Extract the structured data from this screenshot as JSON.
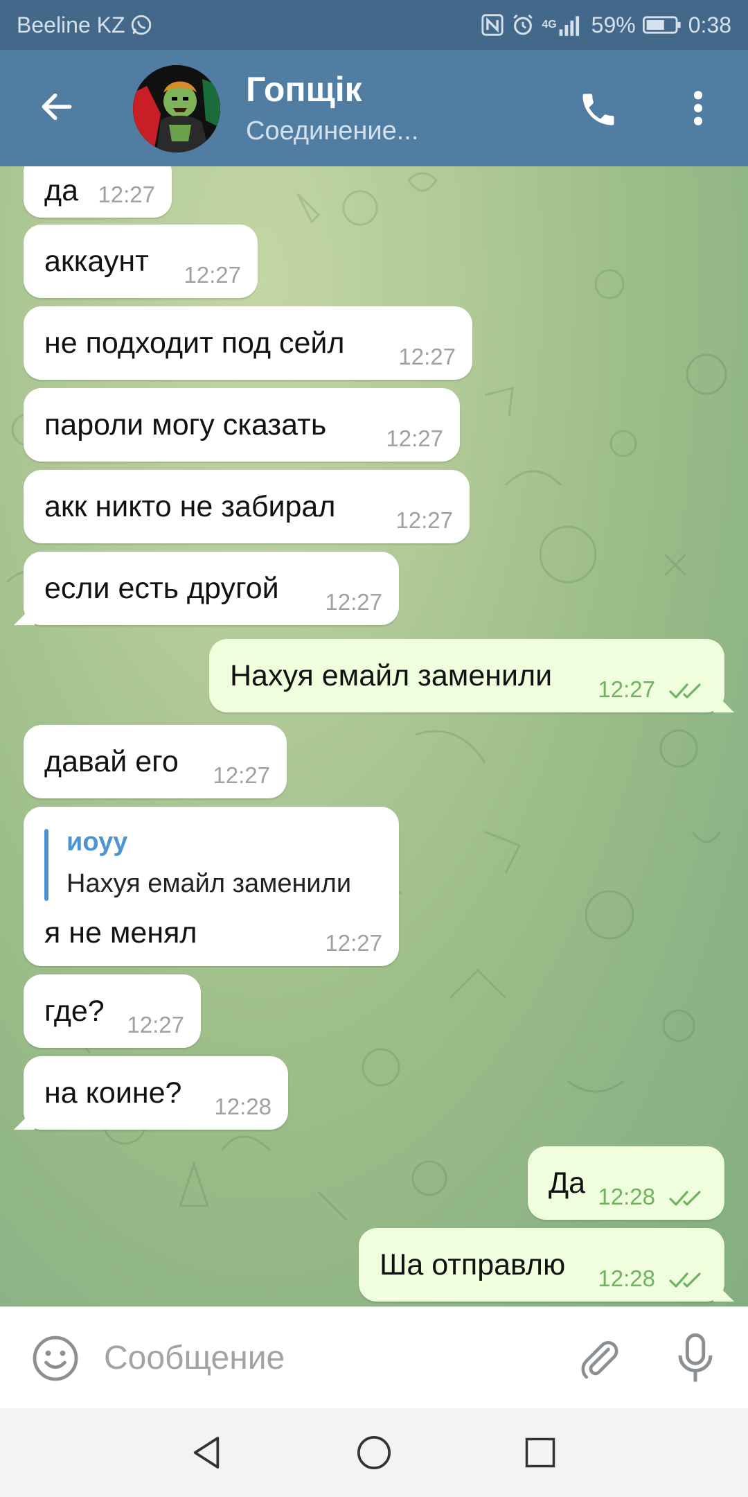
{
  "status_bar": {
    "carrier": "Beeline KZ",
    "network": "4G",
    "battery": "59%",
    "time": "0:38"
  },
  "header": {
    "title": "Гопщік",
    "subtitle": "Соединение..."
  },
  "messages": [
    {
      "dir": "in",
      "text": "да",
      "time": "12:27"
    },
    {
      "dir": "in",
      "text": "аккаунт",
      "time": "12:27"
    },
    {
      "dir": "in",
      "text": "не подходит под сейл",
      "time": "12:27"
    },
    {
      "dir": "in",
      "text": "пароли могу сказать",
      "time": "12:27"
    },
    {
      "dir": "in",
      "text": "акк никто не забирал",
      "time": "12:27"
    },
    {
      "dir": "in",
      "text": "если есть другой",
      "time": "12:27"
    },
    {
      "dir": "out",
      "text": "Нахуя емайл заменили",
      "time": "12:27"
    },
    {
      "dir": "in",
      "text": "давай его",
      "time": "12:27"
    },
    {
      "dir": "in",
      "reply_name": "иоуу",
      "reply_text": "Нахуя емайл заменили",
      "text": "я не менял",
      "time": "12:27"
    },
    {
      "dir": "in",
      "text": "где?",
      "time": "12:27"
    },
    {
      "dir": "in",
      "text": "на коине?",
      "time": "12:28"
    },
    {
      "dir": "out",
      "text": "Да",
      "time": "12:28"
    },
    {
      "dir": "out",
      "text": "Ша отправлю",
      "time": "12:28"
    }
  ],
  "input": {
    "placeholder": "Сообщение"
  },
  "colors": {
    "status_bar": "#44688a",
    "header": "#527da3",
    "incoming_bubble": "#ffffff",
    "outgoing_bubble": "#effedd",
    "read_ticks": "#6fb25f",
    "reply_accent": "#4d94d4"
  }
}
